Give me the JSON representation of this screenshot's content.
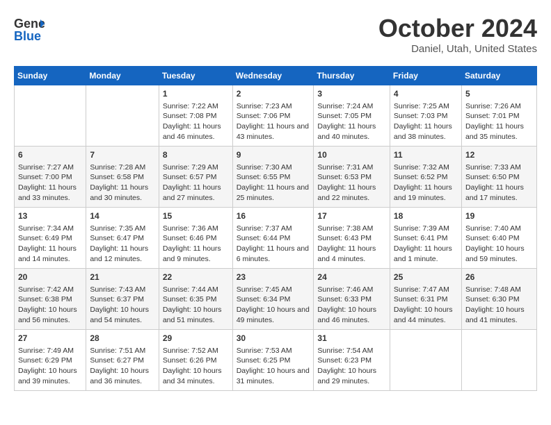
{
  "header": {
    "logo_line1": "General",
    "logo_line2": "Blue",
    "month": "October 2024",
    "location": "Daniel, Utah, United States"
  },
  "days_of_week": [
    "Sunday",
    "Monday",
    "Tuesday",
    "Wednesday",
    "Thursday",
    "Friday",
    "Saturday"
  ],
  "weeks": [
    [
      {
        "day": "",
        "info": ""
      },
      {
        "day": "",
        "info": ""
      },
      {
        "day": "1",
        "info": "Sunrise: 7:22 AM\nSunset: 7:08 PM\nDaylight: 11 hours and 46 minutes."
      },
      {
        "day": "2",
        "info": "Sunrise: 7:23 AM\nSunset: 7:06 PM\nDaylight: 11 hours and 43 minutes."
      },
      {
        "day": "3",
        "info": "Sunrise: 7:24 AM\nSunset: 7:05 PM\nDaylight: 11 hours and 40 minutes."
      },
      {
        "day": "4",
        "info": "Sunrise: 7:25 AM\nSunset: 7:03 PM\nDaylight: 11 hours and 38 minutes."
      },
      {
        "day": "5",
        "info": "Sunrise: 7:26 AM\nSunset: 7:01 PM\nDaylight: 11 hours and 35 minutes."
      }
    ],
    [
      {
        "day": "6",
        "info": "Sunrise: 7:27 AM\nSunset: 7:00 PM\nDaylight: 11 hours and 33 minutes."
      },
      {
        "day": "7",
        "info": "Sunrise: 7:28 AM\nSunset: 6:58 PM\nDaylight: 11 hours and 30 minutes."
      },
      {
        "day": "8",
        "info": "Sunrise: 7:29 AM\nSunset: 6:57 PM\nDaylight: 11 hours and 27 minutes."
      },
      {
        "day": "9",
        "info": "Sunrise: 7:30 AM\nSunset: 6:55 PM\nDaylight: 11 hours and 25 minutes."
      },
      {
        "day": "10",
        "info": "Sunrise: 7:31 AM\nSunset: 6:53 PM\nDaylight: 11 hours and 22 minutes."
      },
      {
        "day": "11",
        "info": "Sunrise: 7:32 AM\nSunset: 6:52 PM\nDaylight: 11 hours and 19 minutes."
      },
      {
        "day": "12",
        "info": "Sunrise: 7:33 AM\nSunset: 6:50 PM\nDaylight: 11 hours and 17 minutes."
      }
    ],
    [
      {
        "day": "13",
        "info": "Sunrise: 7:34 AM\nSunset: 6:49 PM\nDaylight: 11 hours and 14 minutes."
      },
      {
        "day": "14",
        "info": "Sunrise: 7:35 AM\nSunset: 6:47 PM\nDaylight: 11 hours and 12 minutes."
      },
      {
        "day": "15",
        "info": "Sunrise: 7:36 AM\nSunset: 6:46 PM\nDaylight: 11 hours and 9 minutes."
      },
      {
        "day": "16",
        "info": "Sunrise: 7:37 AM\nSunset: 6:44 PM\nDaylight: 11 hours and 6 minutes."
      },
      {
        "day": "17",
        "info": "Sunrise: 7:38 AM\nSunset: 6:43 PM\nDaylight: 11 hours and 4 minutes."
      },
      {
        "day": "18",
        "info": "Sunrise: 7:39 AM\nSunset: 6:41 PM\nDaylight: 11 hours and 1 minute."
      },
      {
        "day": "19",
        "info": "Sunrise: 7:40 AM\nSunset: 6:40 PM\nDaylight: 10 hours and 59 minutes."
      }
    ],
    [
      {
        "day": "20",
        "info": "Sunrise: 7:42 AM\nSunset: 6:38 PM\nDaylight: 10 hours and 56 minutes."
      },
      {
        "day": "21",
        "info": "Sunrise: 7:43 AM\nSunset: 6:37 PM\nDaylight: 10 hours and 54 minutes."
      },
      {
        "day": "22",
        "info": "Sunrise: 7:44 AM\nSunset: 6:35 PM\nDaylight: 10 hours and 51 minutes."
      },
      {
        "day": "23",
        "info": "Sunrise: 7:45 AM\nSunset: 6:34 PM\nDaylight: 10 hours and 49 minutes."
      },
      {
        "day": "24",
        "info": "Sunrise: 7:46 AM\nSunset: 6:33 PM\nDaylight: 10 hours and 46 minutes."
      },
      {
        "day": "25",
        "info": "Sunrise: 7:47 AM\nSunset: 6:31 PM\nDaylight: 10 hours and 44 minutes."
      },
      {
        "day": "26",
        "info": "Sunrise: 7:48 AM\nSunset: 6:30 PM\nDaylight: 10 hours and 41 minutes."
      }
    ],
    [
      {
        "day": "27",
        "info": "Sunrise: 7:49 AM\nSunset: 6:29 PM\nDaylight: 10 hours and 39 minutes."
      },
      {
        "day": "28",
        "info": "Sunrise: 7:51 AM\nSunset: 6:27 PM\nDaylight: 10 hours and 36 minutes."
      },
      {
        "day": "29",
        "info": "Sunrise: 7:52 AM\nSunset: 6:26 PM\nDaylight: 10 hours and 34 minutes."
      },
      {
        "day": "30",
        "info": "Sunrise: 7:53 AM\nSunset: 6:25 PM\nDaylight: 10 hours and 31 minutes."
      },
      {
        "day": "31",
        "info": "Sunrise: 7:54 AM\nSunset: 6:23 PM\nDaylight: 10 hours and 29 minutes."
      },
      {
        "day": "",
        "info": ""
      },
      {
        "day": "",
        "info": ""
      }
    ]
  ]
}
